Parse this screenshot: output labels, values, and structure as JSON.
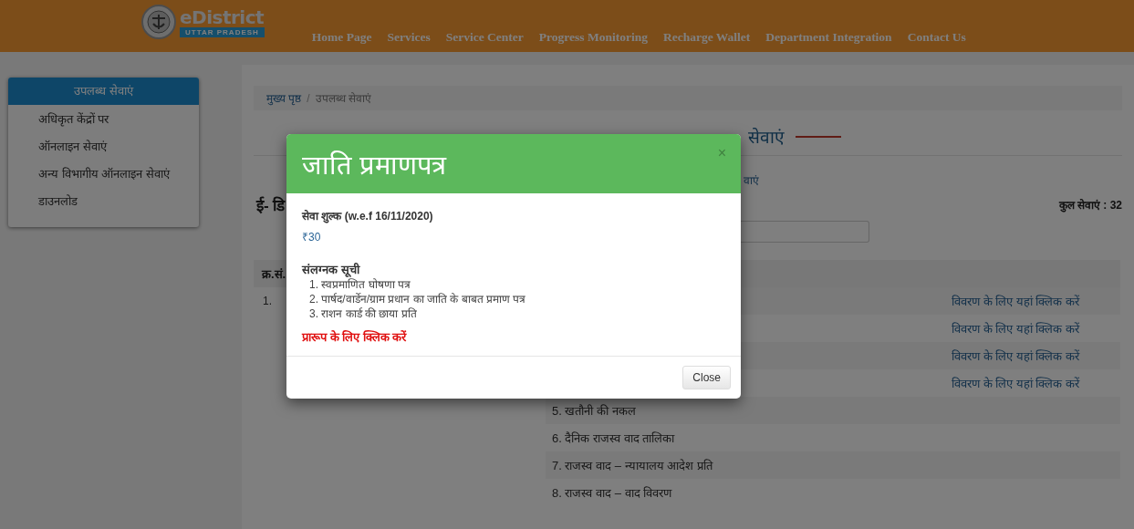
{
  "header": {
    "logo_title": "eDistrict",
    "logo_subtitle": "UTTAR PRADESH",
    "nav": [
      "Home Page",
      "Services",
      "Service Center",
      "Progress Monitoring",
      "Recharge Wallet",
      "Department Integration",
      "Contact Us"
    ]
  },
  "sidebar": {
    "title": "उपलब्ध सेवाएं",
    "items": [
      "अधिकृत केंद्रों पर",
      "ऑनलाइन सेवाएं",
      "अन्य विभागीय ऑनलाइन सेवाएं",
      "डाउनलोड"
    ]
  },
  "breadcrumb_separator": "/",
  "breadcrumb": [
    {
      "label": "मुख्य पृष्ठ",
      "current": false
    },
    {
      "label": "उपलब्ध सेवाएं",
      "current": true
    }
  ],
  "heading_fragment": "सेवाएं",
  "subtitle_fragment": "वाएं",
  "section_fragment": "ई- डि",
  "total": "कुल सेवाएं : 32",
  "table": {
    "serial_header": "क्र.सं.",
    "serials": [
      "1."
    ],
    "sub_rows": [
      {
        "link": "विवरण के लिए यहां क्लिक करें"
      },
      {
        "link": "विवरण के लिए यहां क्लिक करें"
      },
      {
        "link": "विवरण के लिए यहां क्लिक करें"
      },
      {
        "link": "विवरण के लिए यहां क्लिक करें"
      },
      {
        "text": "5. खतौनी की नकल"
      },
      {
        "text": "6. दैनिक राजस्व वाद तालिका"
      },
      {
        "text": "7. राजस्व वाद – न्यायालय आदेश प्रति"
      },
      {
        "text": "8. राजस्व वाद – वाद विवरण"
      }
    ]
  },
  "modal": {
    "title": "जाति प्रमाणपत्र",
    "close_glyph": "×",
    "fee_label": "सेवा शुल्क (w.e.f 16/11/2020)",
    "fee": "₹30",
    "attachments_title": "संलग्नक सूची",
    "attachments": [
      "1. स्वप्रमाणित घोषणा पत्र",
      "2. पार्षद/वार्डेन/ग्राम प्रधान का जाति के बाबत प्रमाण पत्र",
      "3. राशन कार्ड की छाया प्रति"
    ],
    "format_link": "प्रारूप के लिए क्लिक करें",
    "close_button": "Close"
  }
}
